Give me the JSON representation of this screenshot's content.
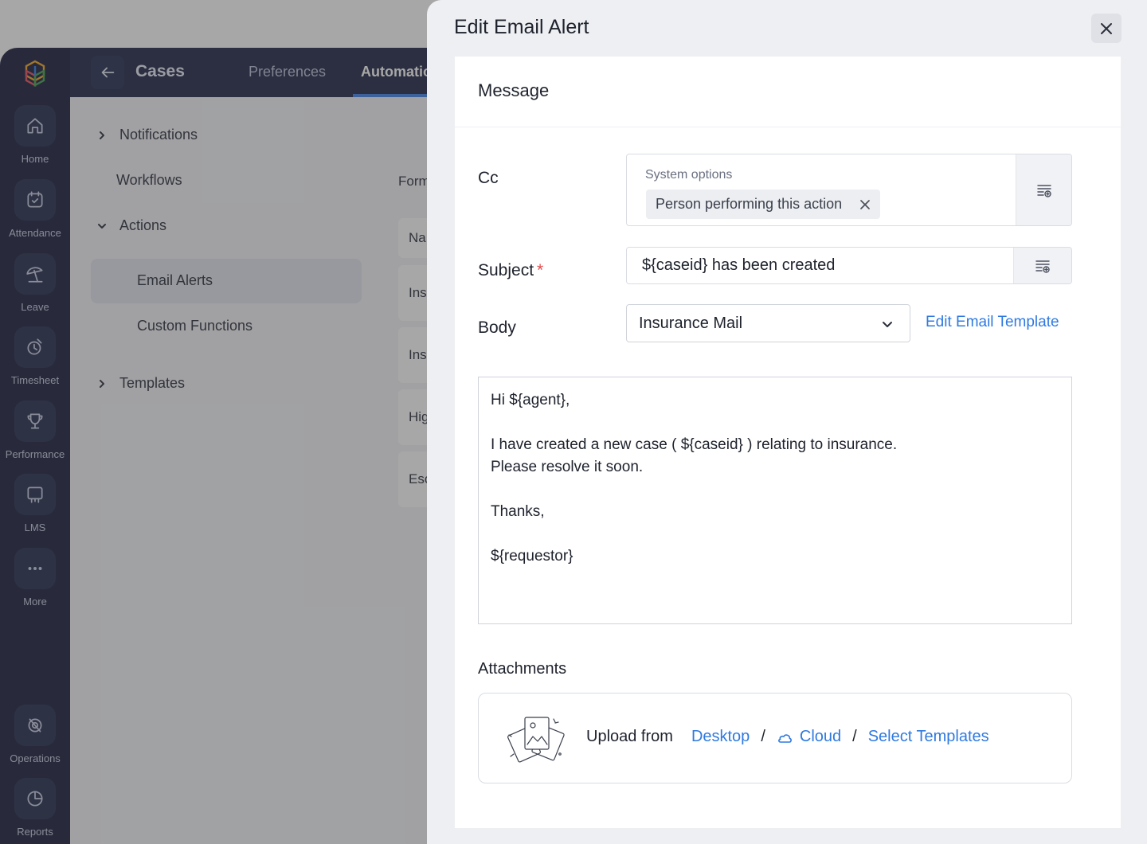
{
  "nav_rail": {
    "items": [
      {
        "label": "Home",
        "icon": "home-icon"
      },
      {
        "label": "Attendance",
        "icon": "calendar-check-icon"
      },
      {
        "label": "Leave",
        "icon": "beach-umbrella-icon"
      },
      {
        "label": "Timesheet",
        "icon": "timer-icon"
      },
      {
        "label": "Performance",
        "icon": "trophy-icon"
      },
      {
        "label": "LMS",
        "icon": "learning-board-icon"
      },
      {
        "label": "More",
        "icon": "more-dots-icon"
      },
      {
        "label": "Operations",
        "icon": "operations-gear-icon"
      },
      {
        "label": "Reports",
        "icon": "pie-chart-icon"
      }
    ]
  },
  "topbar": {
    "title": "Cases",
    "tabs": [
      "Preferences",
      "Automation"
    ]
  },
  "sidebar": {
    "items": [
      {
        "label": "Notifications"
      },
      {
        "label": "Workflows"
      },
      {
        "label": "Actions"
      },
      {
        "label": "Email Alerts"
      },
      {
        "label": "Custom Functions"
      },
      {
        "label": "Templates"
      }
    ]
  },
  "background": {
    "form_label": "Form",
    "rows": [
      "Na",
      "Ins",
      "Ins",
      "Hig",
      "Esc"
    ]
  },
  "drawer": {
    "title": "Edit Email Alert",
    "section_title": "Message",
    "cc": {
      "label": "Cc",
      "caption": "System options",
      "chip": "Person performing this action"
    },
    "subject": {
      "label": "Subject",
      "required_mark": "*",
      "value": "${caseid} has been created"
    },
    "body": {
      "label": "Body",
      "selected_template": "Insurance Mail",
      "edit_link": "Edit Email Template",
      "lines": [
        "Hi  ${agent},",
        "",
        "I have created a new case ( ${caseid} ) relating to insurance.",
        "Please resolve it soon.",
        "",
        "Thanks,",
        "",
        "${requestor}"
      ]
    },
    "attachments": {
      "label": "Attachments",
      "upload_text": "Upload from",
      "desktop": "Desktop",
      "cloud": "Cloud",
      "select_templates": "Select Templates",
      "separator": "/"
    }
  },
  "colors": {
    "rail_bg": "#181d3d",
    "topbar_bg": "#1f2546",
    "accent": "#3f80ea",
    "link": "#2f7ae0",
    "required": "#e24a4a"
  }
}
